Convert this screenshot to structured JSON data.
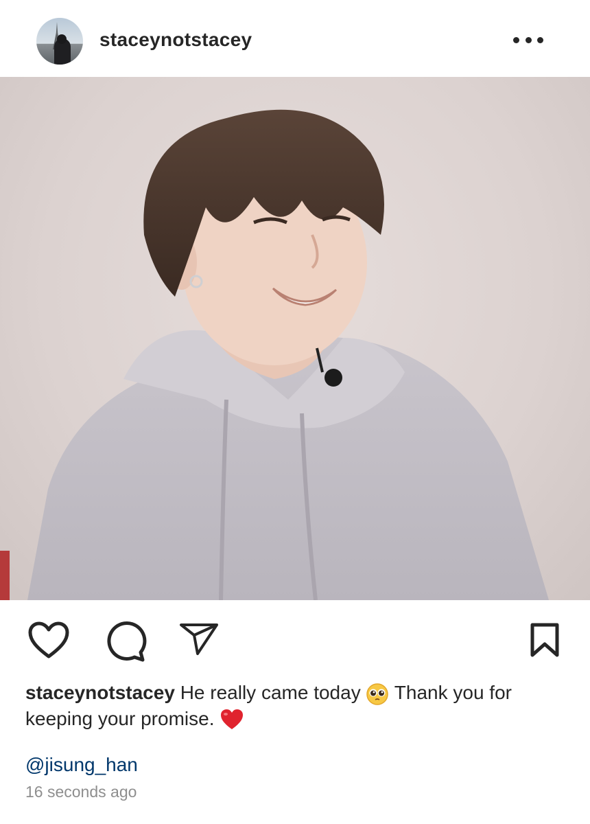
{
  "post": {
    "username": "staceynotstacey",
    "more_icon": "more-horizontal-icon",
    "photo_alt": "photo",
    "actions": {
      "like_icon": "heart-icon",
      "comment_icon": "comment-icon",
      "share_icon": "send-icon",
      "save_icon": "bookmark-icon"
    },
    "caption": {
      "username": "staceynotstacey",
      "text_part1": "He really came today",
      "emoji1": "pleading-face-emoji",
      "text_part2": "Thank you for keeping your promise.",
      "emoji2": "red-heart-emoji"
    },
    "mention": "@jisung_han",
    "timestamp": "16 seconds ago"
  }
}
